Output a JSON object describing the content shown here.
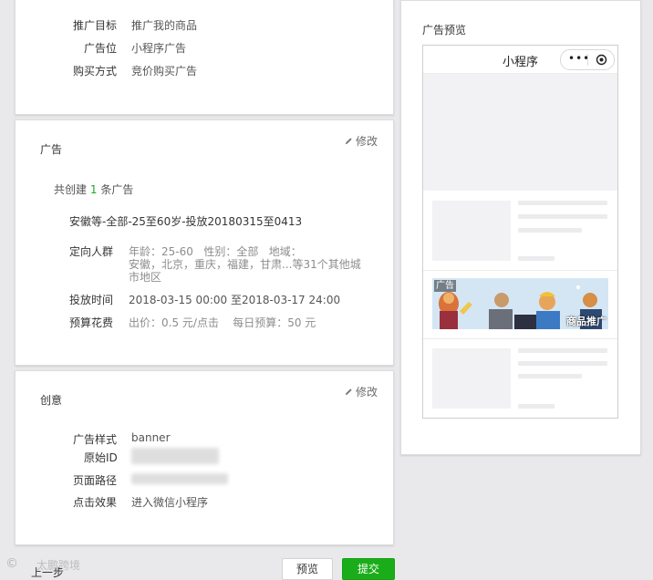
{
  "summary": {
    "target_label": "推广目标",
    "target_value": "推广我的商品",
    "position_label": "广告位",
    "position_value": "小程序广告",
    "buy_label": "购买方式",
    "buy_value": "竞价购买广告"
  },
  "ad": {
    "title": "广告",
    "edit": "修改",
    "created_prefix": "共创建",
    "created_count": "1",
    "created_suffix": "条广告",
    "name": "安徽等-全部-25至60岁-投放20180315至0413",
    "targeting_label": "定向人群",
    "targeting_line1": "年龄：25-60   性别：全部   地域：",
    "targeting_line2": "安徽，北京，重庆，福建，甘肃...等31个其他城",
    "targeting_line3": "市地区",
    "time_label": "投放时间",
    "time_value": "2018-03-15 00:00 至2018-03-17 24:00",
    "budget_label": "预算花费",
    "budget_value": "出价：0.5 元/点击    每日预算：50 元"
  },
  "creative": {
    "title": "创意",
    "edit": "修改",
    "style_label": "广告样式",
    "style_value": "banner",
    "origin_label": "原始ID",
    "page_label": "页面路径",
    "click_label": "点击效果",
    "click_value": "进入微信小程序"
  },
  "preview": {
    "title": "广告预览",
    "miniprogram_title": "小程序",
    "ad_tag": "广告",
    "banner_text": "商品推广"
  },
  "footer": {
    "prev_step": "上一步",
    "preview_button": "预览",
    "submit_button": "提交",
    "watermark": "太鹏跨境"
  },
  "colors": {
    "accent_green": "#1aad19",
    "count_green": "#1aad19"
  }
}
